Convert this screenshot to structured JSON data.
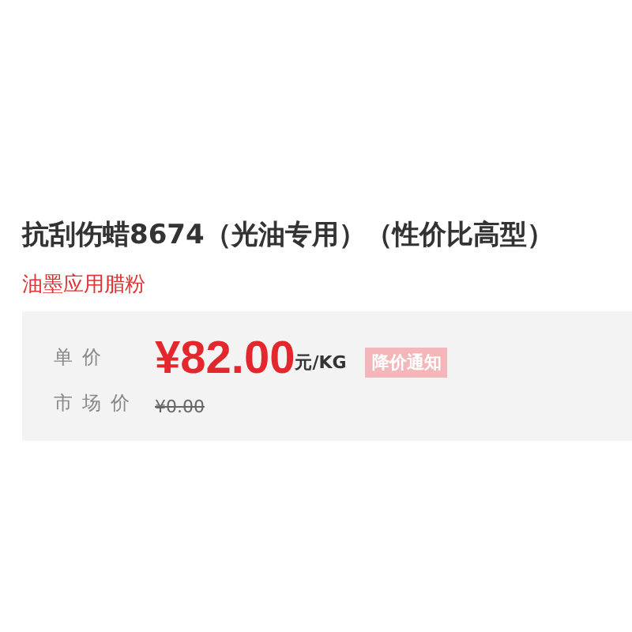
{
  "product": {
    "title": "抗刮伤蜡8674（光油专用）（性价比高型）",
    "subtitle": "油墨应用腊粉"
  },
  "price_panel": {
    "unit_price_label": "单价",
    "price": "¥82.00",
    "unit": "元/KG",
    "notify_badge": "降价通知",
    "market_price_label": "市场价",
    "market_price": "¥0.00"
  }
}
